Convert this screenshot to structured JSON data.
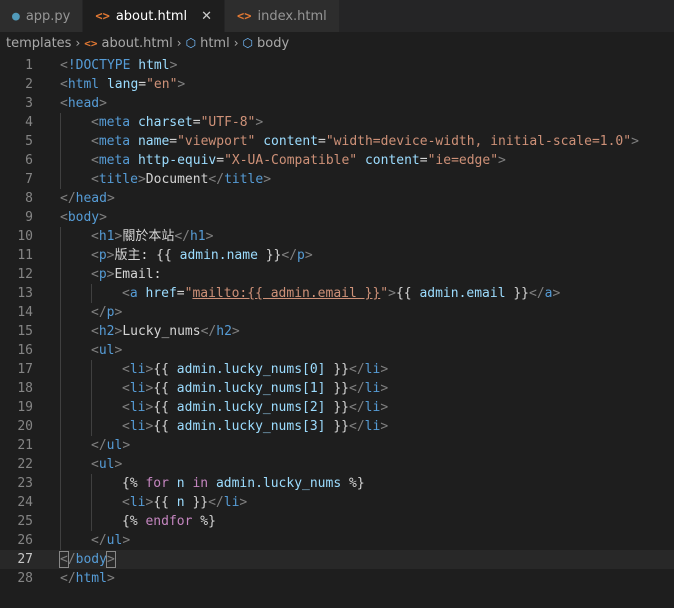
{
  "tabs": [
    {
      "label": "app.py",
      "icon": "python-file-icon",
      "active": false
    },
    {
      "label": "about.html",
      "icon": "html-file-icon",
      "active": true
    },
    {
      "label": "index.html",
      "icon": "html-file-icon",
      "active": false
    }
  ],
  "breadcrumb": [
    "templates",
    "about.html",
    "html",
    "body"
  ],
  "current_line": 27,
  "code_lines": [
    {
      "n": "1",
      "indent": 0,
      "tokens": [
        [
          "p",
          "<"
        ],
        [
          "t",
          "!DOCTYPE"
        ],
        [
          "x",
          " "
        ],
        [
          "a",
          "html"
        ],
        [
          "p",
          ">"
        ]
      ]
    },
    {
      "n": "2",
      "indent": 0,
      "tokens": [
        [
          "p",
          "<"
        ],
        [
          "t",
          "html"
        ],
        [
          "x",
          " "
        ],
        [
          "a",
          "lang"
        ],
        [
          "x",
          "="
        ],
        [
          "s",
          "\"en\""
        ],
        [
          "p",
          ">"
        ]
      ]
    },
    {
      "n": "3",
      "indent": 0,
      "tokens": [
        [
          "p",
          "<"
        ],
        [
          "t",
          "head"
        ],
        [
          "p",
          ">"
        ]
      ]
    },
    {
      "n": "4",
      "indent": 1,
      "tokens": [
        [
          "p",
          "<"
        ],
        [
          "t",
          "meta"
        ],
        [
          "x",
          " "
        ],
        [
          "a",
          "charset"
        ],
        [
          "x",
          "="
        ],
        [
          "s",
          "\"UTF-8\""
        ],
        [
          "p",
          ">"
        ]
      ]
    },
    {
      "n": "5",
      "indent": 1,
      "tokens": [
        [
          "p",
          "<"
        ],
        [
          "t",
          "meta"
        ],
        [
          "x",
          " "
        ],
        [
          "a",
          "name"
        ],
        [
          "x",
          "="
        ],
        [
          "s",
          "\"viewport\""
        ],
        [
          "x",
          " "
        ],
        [
          "a",
          "content"
        ],
        [
          "x",
          "="
        ],
        [
          "s",
          "\"width=device-width, initial-scale=1.0\""
        ],
        [
          "p",
          ">"
        ]
      ]
    },
    {
      "n": "6",
      "indent": 1,
      "tokens": [
        [
          "p",
          "<"
        ],
        [
          "t",
          "meta"
        ],
        [
          "x",
          " "
        ],
        [
          "a",
          "http-equiv"
        ],
        [
          "x",
          "="
        ],
        [
          "s",
          "\"X-UA-Compatible\""
        ],
        [
          "x",
          " "
        ],
        [
          "a",
          "content"
        ],
        [
          "x",
          "="
        ],
        [
          "s",
          "\"ie=edge\""
        ],
        [
          "p",
          ">"
        ]
      ]
    },
    {
      "n": "7",
      "indent": 1,
      "tokens": [
        [
          "p",
          "<"
        ],
        [
          "t",
          "title"
        ],
        [
          "p",
          ">"
        ],
        [
          "x",
          "Document"
        ],
        [
          "p",
          "</"
        ],
        [
          "t",
          "title"
        ],
        [
          "p",
          ">"
        ]
      ]
    },
    {
      "n": "8",
      "indent": 0,
      "tokens": [
        [
          "p",
          "</"
        ],
        [
          "t",
          "head"
        ],
        [
          "p",
          ">"
        ]
      ]
    },
    {
      "n": "9",
      "indent": 0,
      "tokens": [
        [
          "p",
          "<"
        ],
        [
          "t",
          "body"
        ],
        [
          "p",
          ">"
        ]
      ]
    },
    {
      "n": "10",
      "indent": 1,
      "tokens": [
        [
          "p",
          "<"
        ],
        [
          "t",
          "h1"
        ],
        [
          "p",
          ">"
        ],
        [
          "x",
          "關於本站"
        ],
        [
          "p",
          "</"
        ],
        [
          "t",
          "h1"
        ],
        [
          "p",
          ">"
        ]
      ]
    },
    {
      "n": "11",
      "indent": 1,
      "tokens": [
        [
          "p",
          "<"
        ],
        [
          "t",
          "p"
        ],
        [
          "p",
          ">"
        ],
        [
          "x",
          "版主: {{ "
        ],
        [
          "v",
          "admin.name"
        ],
        [
          "x",
          " }}"
        ],
        [
          "p",
          "</"
        ],
        [
          "t",
          "p"
        ],
        [
          "p",
          ">"
        ]
      ]
    },
    {
      "n": "12",
      "indent": 1,
      "tokens": [
        [
          "p",
          "<"
        ],
        [
          "t",
          "p"
        ],
        [
          "p",
          ">"
        ],
        [
          "x",
          "Email:"
        ]
      ]
    },
    {
      "n": "13",
      "indent": 2,
      "tokens": [
        [
          "p",
          "<"
        ],
        [
          "t",
          "a"
        ],
        [
          "x",
          " "
        ],
        [
          "a",
          "href"
        ],
        [
          "x",
          "="
        ],
        [
          "s",
          "\""
        ],
        [
          "u",
          "mailto:{{ admin.email }}"
        ],
        [
          "s",
          "\""
        ],
        [
          "p",
          ">"
        ],
        [
          "x",
          "{{ "
        ],
        [
          "v",
          "admin.email"
        ],
        [
          "x",
          " }}"
        ],
        [
          "p",
          "</"
        ],
        [
          "t",
          "a"
        ],
        [
          "p",
          ">"
        ]
      ]
    },
    {
      "n": "14",
      "indent": 1,
      "tokens": [
        [
          "p",
          "</"
        ],
        [
          "t",
          "p"
        ],
        [
          "p",
          ">"
        ]
      ]
    },
    {
      "n": "15",
      "indent": 1,
      "tokens": [
        [
          "p",
          "<"
        ],
        [
          "t",
          "h2"
        ],
        [
          "p",
          ">"
        ],
        [
          "x",
          "Lucky_nums"
        ],
        [
          "p",
          "</"
        ],
        [
          "t",
          "h2"
        ],
        [
          "p",
          ">"
        ]
      ]
    },
    {
      "n": "16",
      "indent": 1,
      "tokens": [
        [
          "p",
          "<"
        ],
        [
          "t",
          "ul"
        ],
        [
          "p",
          ">"
        ]
      ]
    },
    {
      "n": "17",
      "indent": 2,
      "tokens": [
        [
          "p",
          "<"
        ],
        [
          "t",
          "li"
        ],
        [
          "p",
          ">"
        ],
        [
          "x",
          "{{ "
        ],
        [
          "v",
          "admin.lucky_nums[0]"
        ],
        [
          "x",
          " }}"
        ],
        [
          "p",
          "</"
        ],
        [
          "t",
          "li"
        ],
        [
          "p",
          ">"
        ]
      ]
    },
    {
      "n": "18",
      "indent": 2,
      "tokens": [
        [
          "p",
          "<"
        ],
        [
          "t",
          "li"
        ],
        [
          "p",
          ">"
        ],
        [
          "x",
          "{{ "
        ],
        [
          "v",
          "admin.lucky_nums[1]"
        ],
        [
          "x",
          " }}"
        ],
        [
          "p",
          "</"
        ],
        [
          "t",
          "li"
        ],
        [
          "p",
          ">"
        ]
      ]
    },
    {
      "n": "19",
      "indent": 2,
      "tokens": [
        [
          "p",
          "<"
        ],
        [
          "t",
          "li"
        ],
        [
          "p",
          ">"
        ],
        [
          "x",
          "{{ "
        ],
        [
          "v",
          "admin.lucky_nums[2]"
        ],
        [
          "x",
          " }}"
        ],
        [
          "p",
          "</"
        ],
        [
          "t",
          "li"
        ],
        [
          "p",
          ">"
        ]
      ]
    },
    {
      "n": "20",
      "indent": 2,
      "tokens": [
        [
          "p",
          "<"
        ],
        [
          "t",
          "li"
        ],
        [
          "p",
          ">"
        ],
        [
          "x",
          "{{ "
        ],
        [
          "v",
          "admin.lucky_nums[3]"
        ],
        [
          "x",
          " }}"
        ],
        [
          "p",
          "</"
        ],
        [
          "t",
          "li"
        ],
        [
          "p",
          ">"
        ]
      ]
    },
    {
      "n": "21",
      "indent": 1,
      "tokens": [
        [
          "p",
          "</"
        ],
        [
          "t",
          "ul"
        ],
        [
          "p",
          ">"
        ]
      ]
    },
    {
      "n": "22",
      "indent": 1,
      "tokens": [
        [
          "p",
          "<"
        ],
        [
          "t",
          "ul"
        ],
        [
          "p",
          ">"
        ]
      ]
    },
    {
      "n": "23",
      "indent": 2,
      "tokens": [
        [
          "x",
          "{% "
        ],
        [
          "k",
          "for"
        ],
        [
          "x",
          " "
        ],
        [
          "v",
          "n"
        ],
        [
          "x",
          " "
        ],
        [
          "k",
          "in"
        ],
        [
          "x",
          " "
        ],
        [
          "v",
          "admin.lucky_nums"
        ],
        [
          "x",
          " %}"
        ]
      ]
    },
    {
      "n": "24",
      "indent": 2,
      "tokens": [
        [
          "p",
          "<"
        ],
        [
          "t",
          "li"
        ],
        [
          "p",
          ">"
        ],
        [
          "x",
          "{{ "
        ],
        [
          "v",
          "n"
        ],
        [
          "x",
          " }}"
        ],
        [
          "p",
          "</"
        ],
        [
          "t",
          "li"
        ],
        [
          "p",
          ">"
        ]
      ]
    },
    {
      "n": "25",
      "indent": 2,
      "tokens": [
        [
          "x",
          "{% "
        ],
        [
          "k",
          "endfor"
        ],
        [
          "x",
          " %}"
        ]
      ]
    },
    {
      "n": "26",
      "indent": 1,
      "tokens": [
        [
          "p",
          "</"
        ],
        [
          "t",
          "ul"
        ],
        [
          "p",
          ">"
        ]
      ]
    },
    {
      "n": "27",
      "indent": 0,
      "tokens": [
        [
          "b",
          "<"
        ],
        [
          "p",
          "/"
        ],
        [
          "t",
          "body"
        ],
        [
          "b",
          ">"
        ]
      ]
    },
    {
      "n": "28",
      "indent": 0,
      "tokens": [
        [
          "p",
          "</"
        ],
        [
          "t",
          "html"
        ],
        [
          "p",
          ">"
        ]
      ]
    }
  ],
  "colors": {
    "editor_bg": "#1e1e1e",
    "tag": "#569cd6",
    "attribute": "#9cdcfe",
    "string": "#ce9178",
    "keyword": "#c586c0",
    "html_icon": "#e37933",
    "python_icon": "#519aba"
  }
}
